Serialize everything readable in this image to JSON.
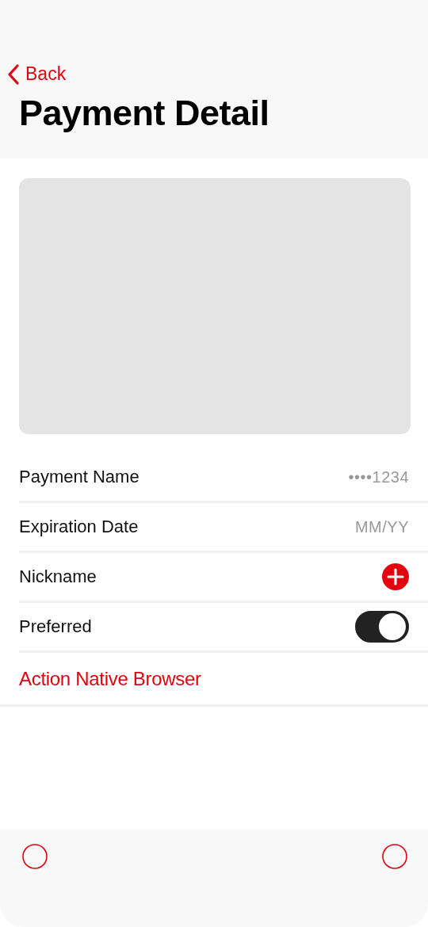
{
  "nav": {
    "back": "Back",
    "title": "Payment Detail"
  },
  "card": {
    "kind": "placeholder"
  },
  "rows": [
    {
      "kind": "value",
      "label": "Payment Name",
      "value": "••••1234"
    },
    {
      "kind": "value",
      "label": "Expiration Date",
      "value": "MM/YY"
    },
    {
      "kind": "add",
      "label": "Nickname"
    },
    {
      "kind": "toggle",
      "label": "Preferred",
      "on": true
    }
  ],
  "action": "Action Native Browser",
  "tab_bar": [
    {
      "kind": "circle"
    },
    {
      "kind": "circle"
    }
  ]
}
